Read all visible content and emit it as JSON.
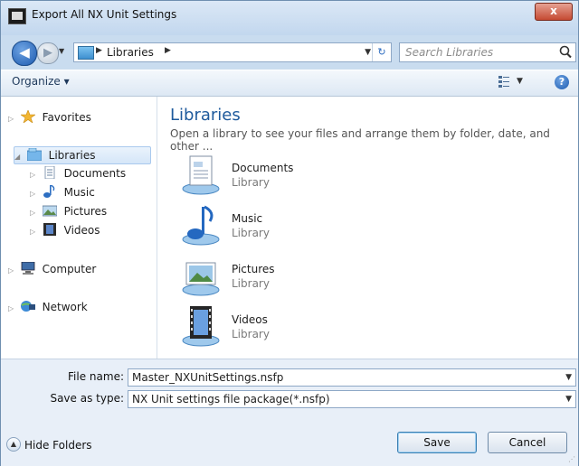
{
  "window": {
    "title": "Export All NX Unit Settings",
    "close_label": "x"
  },
  "nav": {
    "back_label": "◀",
    "forward_label": "▶",
    "address_segment": "Libraries",
    "search_placeholder": "Search Libraries"
  },
  "toolbar": {
    "organize_label": "Organize ▾",
    "help_label": "?"
  },
  "sidebar": {
    "favorites": "Favorites",
    "libraries": "Libraries",
    "documents": "Documents",
    "music": "Music",
    "pictures": "Pictures",
    "videos": "Videos",
    "computer": "Computer",
    "network": "Network"
  },
  "main": {
    "heading": "Libraries",
    "subheading": "Open a library to see your files and arrange them by folder, date, and other ...",
    "items": [
      {
        "name": "Documents",
        "type": "Library"
      },
      {
        "name": "Music",
        "type": "Library"
      },
      {
        "name": "Pictures",
        "type": "Library"
      },
      {
        "name": "Videos",
        "type": "Library"
      }
    ]
  },
  "form": {
    "file_name_label": "File name:",
    "file_name_value": "Master_NXUnitSettings.nsfp",
    "save_type_label": "Save as type:",
    "save_type_value": "NX Unit settings file package(*.nsfp)"
  },
  "footer": {
    "hide_folders": "Hide Folders",
    "save": "Save",
    "cancel": "Cancel"
  }
}
